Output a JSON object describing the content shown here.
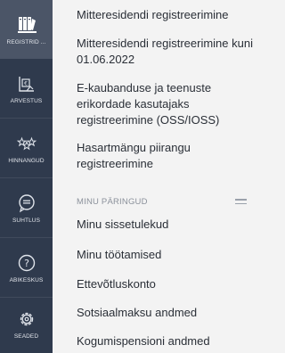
{
  "sidebar": {
    "items": [
      {
        "label": "REGISTRID ...",
        "icon": "registers-icon",
        "active": true
      },
      {
        "label": "ARVESTUS",
        "icon": "accounting-icon"
      },
      {
        "label": "HINNANGUD",
        "icon": "ratings-icon"
      },
      {
        "label": "SUHTLUS",
        "icon": "chat-icon"
      },
      {
        "label": "ABIKESKUS",
        "icon": "help-icon"
      },
      {
        "label": "SEADED",
        "icon": "gear-icon"
      }
    ]
  },
  "menu": {
    "links": [
      {
        "label": "Mitteresidendi registreerimine"
      },
      {
        "label": "Mitteresidendi registreerimine kuni 01.06.2022"
      },
      {
        "label": "E-kaubanduse ja teenuste erikordade kasutajaks registreerimine (OSS/IOSS)"
      },
      {
        "label": "Hasartmängu piirangu registreerimine"
      }
    ],
    "section_title": "MINU PÄRINGUD",
    "queries": [
      {
        "label": "Minu sissetulekud"
      },
      {
        "label": "Minu töötamised"
      },
      {
        "label": "Ettevõtluskonto"
      },
      {
        "label": "Sotsiaalmaksu andmed"
      },
      {
        "label": "Kogumispensioni andmed"
      }
    ]
  },
  "colors": {
    "sidebar_bg": "#2f3a4d",
    "sidebar_active_bg": "#4b5567",
    "panel_bg": "#f3f3f3",
    "text": "#2a2f37",
    "section_text": "#8b919b"
  }
}
